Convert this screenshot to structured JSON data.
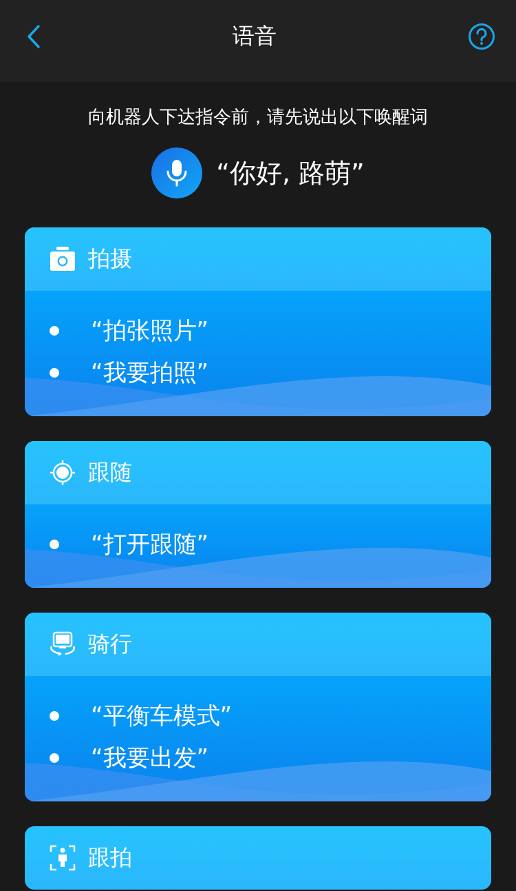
{
  "header": {
    "title": "语音"
  },
  "instruction": "向机器人下达指令前，请先说出以下唤醒词",
  "wake_word": "“你好, 路萌”",
  "sections": [
    {
      "title": "拍摄",
      "kind": "camera",
      "phrases": [
        "“拍张照片”",
        "“我要拍照”"
      ]
    },
    {
      "title": "跟随",
      "kind": "target",
      "phrases": [
        "“打开跟随”"
      ]
    },
    {
      "title": "骑行",
      "kind": "ride",
      "phrases": [
        "“平衡车模式”",
        "“我要出发”"
      ]
    },
    {
      "title": "跟拍",
      "kind": "person"
    }
  ]
}
